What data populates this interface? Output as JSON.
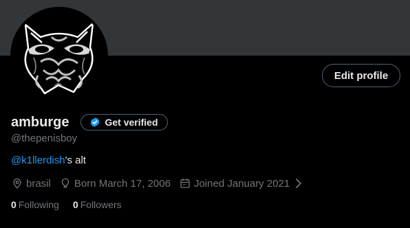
{
  "profile": {
    "display_name": "amburge",
    "handle": "@thepenisboy",
    "bio_mention": "@k1llerdish",
    "bio_rest": "'s alt",
    "location": "brasil",
    "born": "Born March 17, 2006",
    "joined": "Joined January 2021",
    "following_count": "0",
    "following_label": "Following",
    "followers_count": "0",
    "followers_label": "Followers"
  },
  "buttons": {
    "edit_profile": "Edit profile",
    "get_verified": "Get verified"
  },
  "colors": {
    "background": "#000000",
    "banner": "#333639",
    "text_primary": "#e7e9ea",
    "text_secondary": "#71767b",
    "accent": "#1d9bf0",
    "border": "#536471"
  },
  "icons": {
    "location": "location-pin-icon",
    "born": "balloon-icon",
    "joined": "calendar-icon",
    "joined_more": "chevron-right-icon",
    "verified": "verified-badge-icon"
  }
}
